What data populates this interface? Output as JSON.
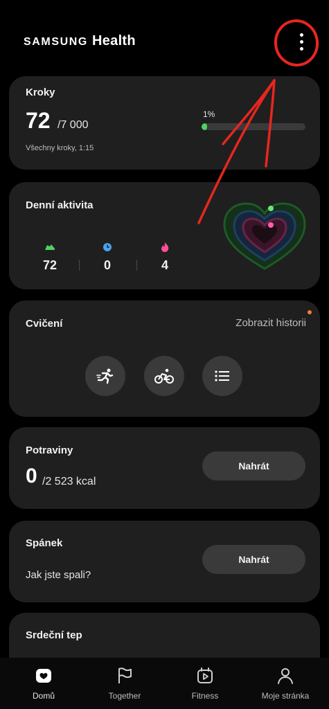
{
  "header": {
    "brand_part1": "SAMSUNG",
    "brand_part2": "Health",
    "more_icon": "more-vertical-icon"
  },
  "steps": {
    "title": "Kroky",
    "value": "72",
    "goal": "/7 000",
    "note": "Všechny kroky, 1:15",
    "percent_label": "1%",
    "progress_fraction": 0.01,
    "progress_color": "#53d060"
  },
  "activity": {
    "title": "Denní aktivita",
    "stats": [
      {
        "icon": "shoe-icon",
        "value": "72",
        "color": "#53d060"
      },
      {
        "icon": "clock-icon",
        "value": "0",
        "color": "#4aa3f0"
      },
      {
        "icon": "flame-icon",
        "value": "4",
        "color": "#ff4f9a"
      }
    ]
  },
  "exercise": {
    "title": "Cvičení",
    "history_link": "Zobrazit historii",
    "buttons": [
      "running-icon",
      "cycling-icon",
      "list-icon"
    ]
  },
  "food": {
    "title": "Potraviny",
    "value": "0",
    "goal": "/2 523 kcal",
    "button": "Nahrát"
  },
  "sleep": {
    "title": "Spánek",
    "question": "Jak jste spali?",
    "button": "Nahrát"
  },
  "heart_rate": {
    "title": "Srdeční tep"
  },
  "nav": {
    "items": [
      {
        "label": "Domů",
        "icon": "home-icon"
      },
      {
        "label": "Together",
        "icon": "flag-icon"
      },
      {
        "label": "Fitness",
        "icon": "play-icon"
      },
      {
        "label": "Moje stránka",
        "icon": "person-icon"
      }
    ]
  },
  "colors": {
    "accent_annotation": "#e8261f",
    "card_bg": "#1f1f1f",
    "button_bg": "#3a3a3a"
  }
}
